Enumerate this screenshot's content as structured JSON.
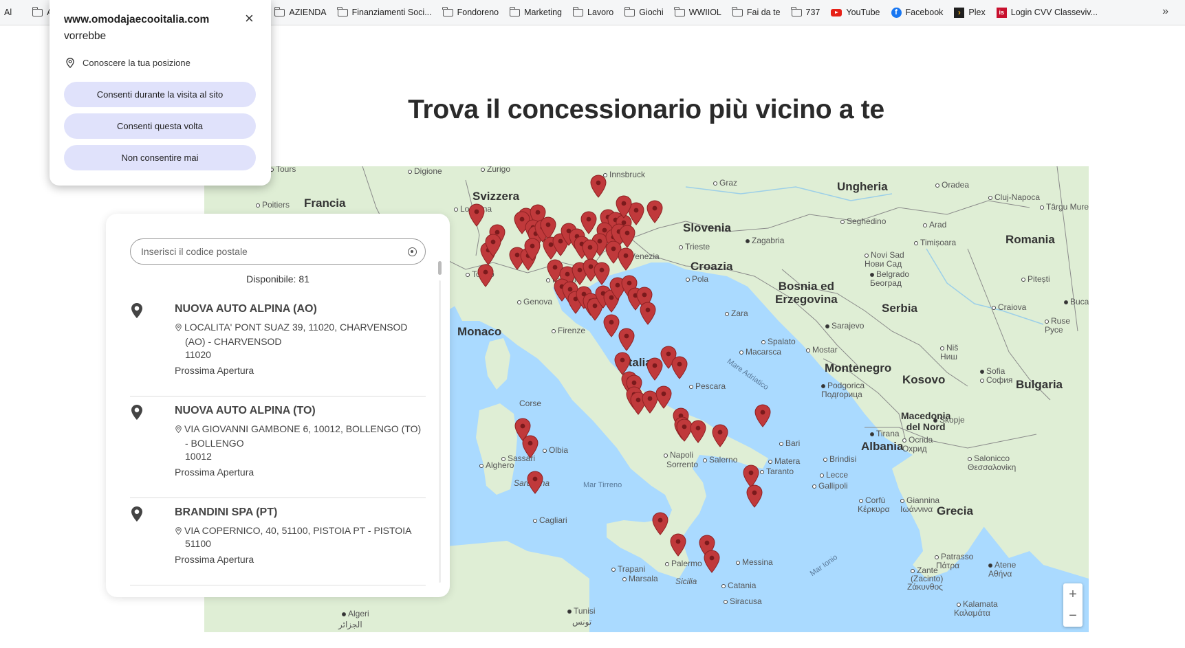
{
  "bookmarks": {
    "items": [
      {
        "label": "Al",
        "icon": "none"
      },
      {
        "label": "Ap",
        "icon": "folder-icon"
      },
      {
        "label": "AZIENDA",
        "icon": "folder-icon"
      },
      {
        "label": "Finanziamenti Soci...",
        "icon": "folder-icon"
      },
      {
        "label": "Fondoreno",
        "icon": "folder-icon"
      },
      {
        "label": "Marketing",
        "icon": "folder-icon"
      },
      {
        "label": "Lavoro",
        "icon": "folder-icon"
      },
      {
        "label": "Giochi",
        "icon": "folder-icon"
      },
      {
        "label": "WWIIOL",
        "icon": "folder-icon"
      },
      {
        "label": "Fai da te",
        "icon": "folder-icon"
      },
      {
        "label": "737",
        "icon": "folder-icon"
      },
      {
        "label": "YouTube",
        "icon": "youtube-icon"
      },
      {
        "label": "Facebook",
        "icon": "facebook-icon"
      },
      {
        "label": "Plex",
        "icon": "plex-icon"
      },
      {
        "label": "Login CVV Classeviv...",
        "icon": "classeviva-icon"
      }
    ],
    "more": "»"
  },
  "permission_popup": {
    "site": "www.omodajaecooitalia.com",
    "wants": "vorrebbe",
    "close": "×",
    "permission_label": "Conoscere la tua posizione",
    "buttons": {
      "allow_while_visiting": "Consenti durante la visita al sito",
      "allow_this_time": "Consenti questa volta",
      "never_allow": "Non consentire mai"
    }
  },
  "page": {
    "title": "Trova il concessionario più vicino a te"
  },
  "dealer_panel": {
    "search_placeholder": "Inserisci il codice postale",
    "available": "Disponibile: 81",
    "dealers": [
      {
        "name": "NUOVA AUTO ALPINA (AO)",
        "address": "LOCALITA' PONT SUAZ 39, 11020, CHARVENSOD (AO) - CHARVENSOD",
        "zip": "11020",
        "status": "Prossima Apertura"
      },
      {
        "name": "NUOVA AUTO ALPINA (TO)",
        "address": "VIA GIOVANNI GAMBONE 6, 10012, BOLLENGO (TO) - BOLLENGO",
        "zip": "10012",
        "status": "Prossima Apertura"
      },
      {
        "name": "BRANDINI SPA (PT)",
        "address": "VIA COPERNICO, 40, 51100, PISTOIA PT - PISTOIA",
        "zip": "51100",
        "status": "Prossima Apertura"
      }
    ]
  },
  "map": {
    "countries": [
      "Svizzera",
      "Francia",
      "Slovenia",
      "Croazia",
      "Bosnia ed Erzegovina",
      "Serbia",
      "Ungheria",
      "Romania",
      "Montenegro",
      "Kosovo",
      "Macedonia del Nord",
      "Albania",
      "Bulgaria",
      "Grecia",
      "Monaco",
      "Italia"
    ],
    "cities": [
      "Tours",
      "Digione",
      "Zurigo",
      "Innsbruck",
      "Graz",
      "Oradea",
      "Cluj-Napoca",
      "Târgu Mureș",
      "Poitiers",
      "Losanna",
      "Seghedino",
      "Arad",
      "Timișoara",
      "Trieste",
      "Zagabria",
      "Venezia",
      "Torino",
      "Parma",
      "Novi Sad",
      "Нови Сад",
      "Belgrado",
      "Београд",
      "Pitești",
      "Pola",
      "Genova",
      "Craiova",
      "Buca",
      "Zara",
      "Sarajevo",
      "Firenze",
      "Ruse",
      "Русе",
      "Spalato",
      "Niš",
      "Ниш",
      "Macarsca",
      "Mostar",
      "Pescara",
      "Sofia",
      "София",
      "Corse",
      "Podgorica",
      "Подгорица",
      "Skopje",
      "Tirana",
      "Ocrida",
      "Охрид",
      "Olbia",
      "Sassari",
      "Bari",
      "Napoli",
      "Sorrento",
      "Salerno",
      "Matera",
      "Taranto",
      "Brindisi",
      "Salonicco",
      "Θεσσαλονίκη",
      "Alghero",
      "Sardegna",
      "Lecce",
      "Gallipoli",
      "Corfù",
      "Κέρκυρα",
      "Giannina",
      "Ιωάννινα",
      "Cagliari",
      "Patrasso",
      "Πάτρα",
      "Messina",
      "Palermo",
      "Trapani",
      "Marsala",
      "Sicilia",
      "Catania",
      "Zante",
      "(Zacinto)",
      "Ζάκυνθος",
      "Atene",
      "Αθήνα",
      "Siracusa",
      "Algeri",
      "الجزائر",
      "Tunisi",
      "تونس",
      "Kalamata",
      "Καλαμάτα"
    ],
    "seas": [
      "Mar Tirreno",
      "Mare Adriatico",
      "Mar Ionio"
    ],
    "pin_count": 81,
    "zoom_in": "+",
    "zoom_out": "−",
    "colors": {
      "pin": "#c0393b",
      "land": "#dfeed5",
      "water": "#aadaff"
    }
  }
}
